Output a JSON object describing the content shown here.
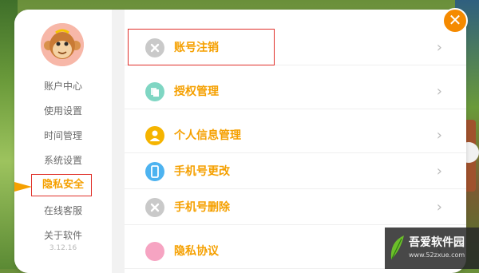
{
  "sidebar": {
    "items": [
      {
        "label": "账户中心"
      },
      {
        "label": "使用设置"
      },
      {
        "label": "时间管理"
      },
      {
        "label": "系统设置"
      },
      {
        "label": "隐私安全"
      },
      {
        "label": "在线客服"
      },
      {
        "label": "关于软件"
      }
    ],
    "active_index": 4,
    "version": "3.12.16"
  },
  "settings": {
    "rows": [
      {
        "label": "账号注销",
        "icon": "close-circle-icon",
        "icon_color": "#c9c9c9"
      },
      {
        "label": "授权管理",
        "icon": "authorization-icon",
        "icon_color": "#7fd6c3"
      },
      {
        "label": "个人信息管理",
        "icon": "person-icon",
        "icon_color": "#f5b400"
      },
      {
        "label": "手机号更改",
        "icon": "phone-icon",
        "icon_color": "#4db3f0"
      },
      {
        "label": "手机号删除",
        "icon": "close-circle-icon",
        "icon_color": "#c9c9c9"
      },
      {
        "label": "隐私协议",
        "icon": "privacy-icon",
        "icon_color": "#f6a4c2"
      }
    ]
  },
  "close": {
    "glyph": "✕"
  },
  "watermark": {
    "title": "吾爱软件园",
    "url": "www.52zxue.com"
  },
  "colors": {
    "accent": "#f5a000",
    "highlight": "#e0302a",
    "close": "#f58a00"
  }
}
